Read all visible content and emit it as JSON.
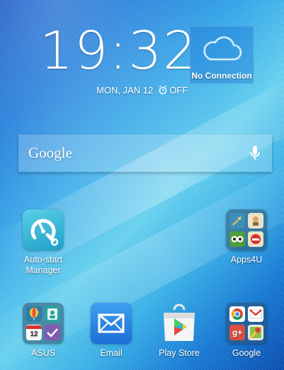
{
  "clock": {
    "time": "19:32"
  },
  "date": {
    "text": "MON, JAN 12",
    "alarm": "OFF"
  },
  "weather": {
    "status": "No Connection"
  },
  "search": {
    "brand": "Google"
  },
  "apps": [
    {
      "label": "Auto-start\nManager",
      "icon": "speedometer-wrench-icon"
    },
    {
      "label": "Apps4U",
      "icon": "apps4u-folder-icon"
    },
    {
      "label": "ASUS",
      "icon": "asus-folder-icon"
    },
    {
      "label": "Email",
      "icon": "email-icon"
    },
    {
      "label": "Play Store",
      "icon": "play-store-icon"
    },
    {
      "label": "Google",
      "icon": "google-folder-icon"
    }
  ],
  "asus_folder": {
    "calendar_day": "12"
  },
  "google_folder": {
    "gplus": "g+"
  }
}
